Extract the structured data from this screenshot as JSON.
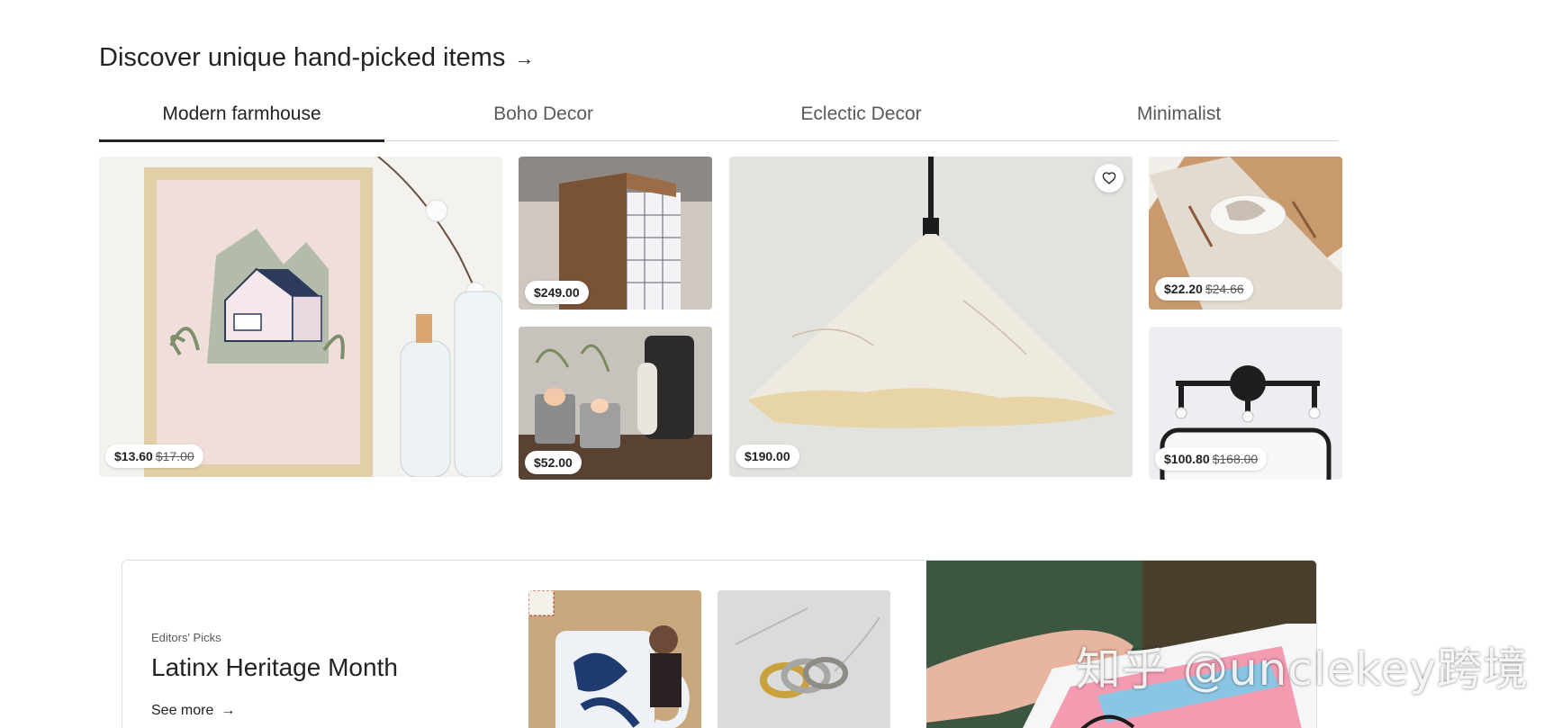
{
  "section": {
    "title": "Discover unique hand-picked items",
    "arrow_icon": "arrow-right-icon"
  },
  "tabs": [
    {
      "label": "Modern farmhouse",
      "active": true
    },
    {
      "label": "Boho Decor",
      "active": false
    },
    {
      "label": "Eclectic Decor",
      "active": false
    },
    {
      "label": "Minimalist",
      "active": false
    }
  ],
  "products": {
    "print": {
      "price": "$13.60",
      "original": "$17.00"
    },
    "side_table": {
      "price": "$249.00"
    },
    "candles": {
      "price": "$52.00"
    },
    "pendant_lamp": {
      "price": "$190.00",
      "favorite_icon": "heart-icon"
    },
    "table_runner": {
      "price": "$22.20",
      "original": "$24.66"
    },
    "wall_sconce": {
      "price": "$100.80",
      "original": "$168.00"
    }
  },
  "editors_picks": {
    "eyebrow": "Editors' Picks",
    "title": "Latinx Heritage Month",
    "see_more": "See more"
  },
  "watermark": "知乎 @unclekey跨境",
  "colors": {
    "text": "#222222",
    "muted": "#595959",
    "divider": "#d6d6d6"
  }
}
